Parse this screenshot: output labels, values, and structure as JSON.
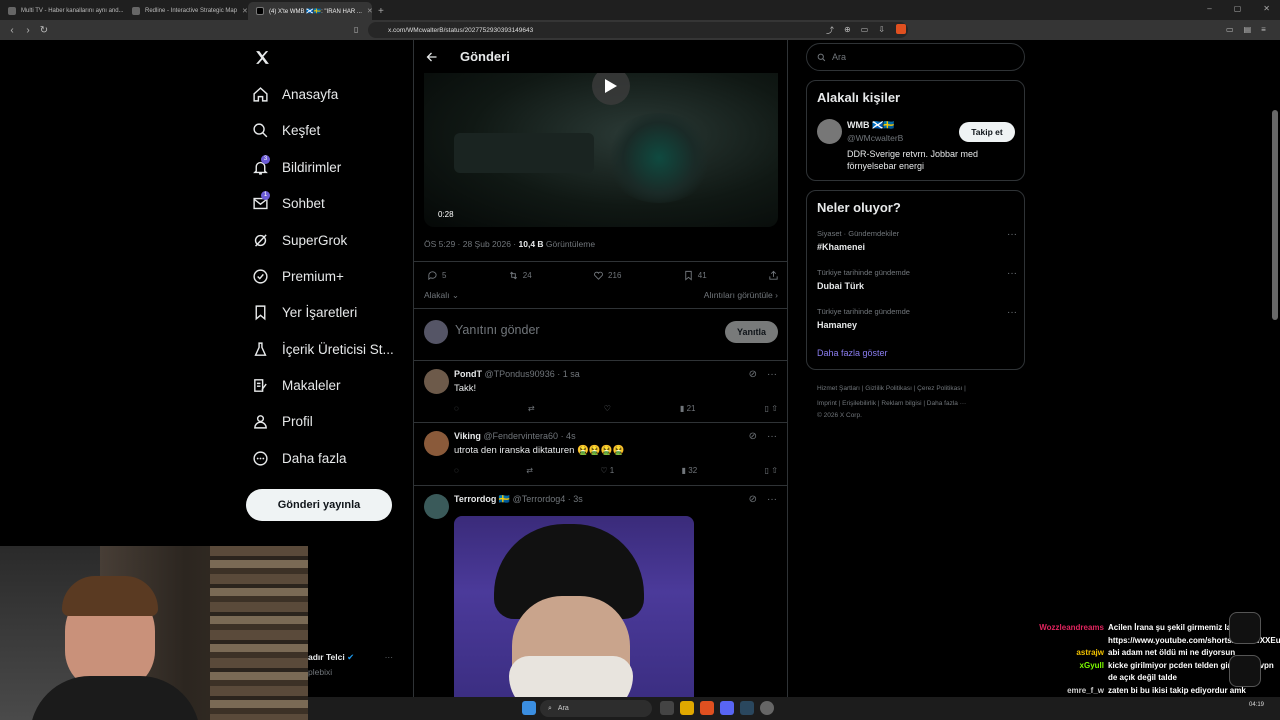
{
  "browser": {
    "tabs": [
      {
        "label": "Multi TV - Haber kanallarını aynı and..."
      },
      {
        "label": "Redline - Interactive Strategic Map"
      },
      {
        "label": "(4) X'te WMB 🏴󠁧󠁢󠁳󠁣󠁴󠁿🇸🇪: \"IRAN HAR ..."
      }
    ],
    "url": "x.com/WMcwalterB/status/2027752930393149643"
  },
  "nav": {
    "items": [
      {
        "label": "Anasayfa",
        "icon": "home-icon"
      },
      {
        "label": "Keşfet",
        "icon": "search-icon"
      },
      {
        "label": "Bildirimler",
        "icon": "bell-icon",
        "badge": "3"
      },
      {
        "label": "Sohbet",
        "icon": "mail-icon",
        "badge": "1"
      },
      {
        "label": "SuperGrok",
        "icon": "grok-icon"
      },
      {
        "label": "Premium+",
        "icon": "premium-icon"
      },
      {
        "label": "Yer İşaretleri",
        "icon": "bookmark-icon"
      },
      {
        "label": "İçerik Üreticisi St...",
        "icon": "flask-icon"
      },
      {
        "label": "Makaleler",
        "icon": "article-icon"
      },
      {
        "label": "Profil",
        "icon": "person-icon"
      },
      {
        "label": "Daha fazla",
        "icon": "more-circle-icon"
      }
    ],
    "post_button": "Gönderi yayınla"
  },
  "account": {
    "name": "adır Telci",
    "handle": "plebixi"
  },
  "main": {
    "header_title": "Gönderi",
    "video_time": "0:28",
    "timestamp": "ÖS 5:29 · 28 Şub 2026 · ",
    "views_count": "10,4 B",
    "views_label": " Görüntüleme",
    "stats": {
      "replies": "5",
      "reposts": "24",
      "likes": "216",
      "bookmarks": "41"
    },
    "related_left": "Alakalı",
    "related_right": "Alıntıları görüntüle",
    "reply_placeholder": "Yanıtını gönder",
    "reply_button": "Yanıtla",
    "replies": [
      {
        "name": "PondT",
        "handle": "@TPondus90936",
        "time": "· 1 sa",
        "text": "Takk!",
        "likes": "",
        "views": "21"
      },
      {
        "name": "Viking",
        "handle": "@Fendervintera60",
        "time": "· 4s",
        "text": "utrota den iranska diktaturen 🤮🤮🤮🤮",
        "likes": "1",
        "views": "32"
      },
      {
        "name": "Terrordog 🇸🇪",
        "handle": "@Terrordog4",
        "time": "· 3s",
        "text": "",
        "likes": "",
        "views": ""
      }
    ]
  },
  "sidebar": {
    "search_placeholder": "Ara",
    "relevant_title": "Alakalı kişiler",
    "person": {
      "name": "WMB 🏴󠁧󠁢󠁳󠁣󠁴󠁿🇸🇪",
      "handle": "@WMcwalterB",
      "bio": "DDR-Sverige retvrn. Jobbar med förnyelsebar energi",
      "follow": "Takip et"
    },
    "trends_title": "Neler oluyor?",
    "trends": [
      {
        "category": "Siyaset · Gündemdekiler",
        "name": "#Khamenei"
      },
      {
        "category": "Türkiye tarihinde gündemde",
        "name": "Dubai Türk"
      },
      {
        "category": "Türkiye tarihinde gündemde",
        "name": "Hamaney"
      }
    ],
    "show_more": "Daha fazla göster",
    "footer_line1": "Hizmet Şartları  |  Gizlilik Politikası  |  Çerez Politikası  |",
    "footer_line2": "Imprint  |  Erişilebilirlik  |  Reklam bilgisi  |  Daha fazla ···",
    "footer_line3": "© 2026 X Corp."
  },
  "chat": [
    {
      "user": "Wozzleandreams",
      "color": "#e0245e",
      "text": "Acilen İrana şu şekil girmemiz lazım https://www.youtube.com/shorts/uOrEwXXEucg"
    },
    {
      "user": "astrajw",
      "color": "#f0c000",
      "text": "abi adam net öldü mi ne diyorsun"
    },
    {
      "user": "xGyull",
      "color": "#7cfc00",
      "text": "kicke girilmiyor pcden telden giriyorum vpn de açık değil talde"
    },
    {
      "user": "emre_f_w",
      "color": "#cfcfcf",
      "text": "zaten bi bu ikisi takip ediyordur amk"
    }
  ],
  "taskbar": {
    "search_placeholder": "Ara",
    "clock": "04:19"
  }
}
